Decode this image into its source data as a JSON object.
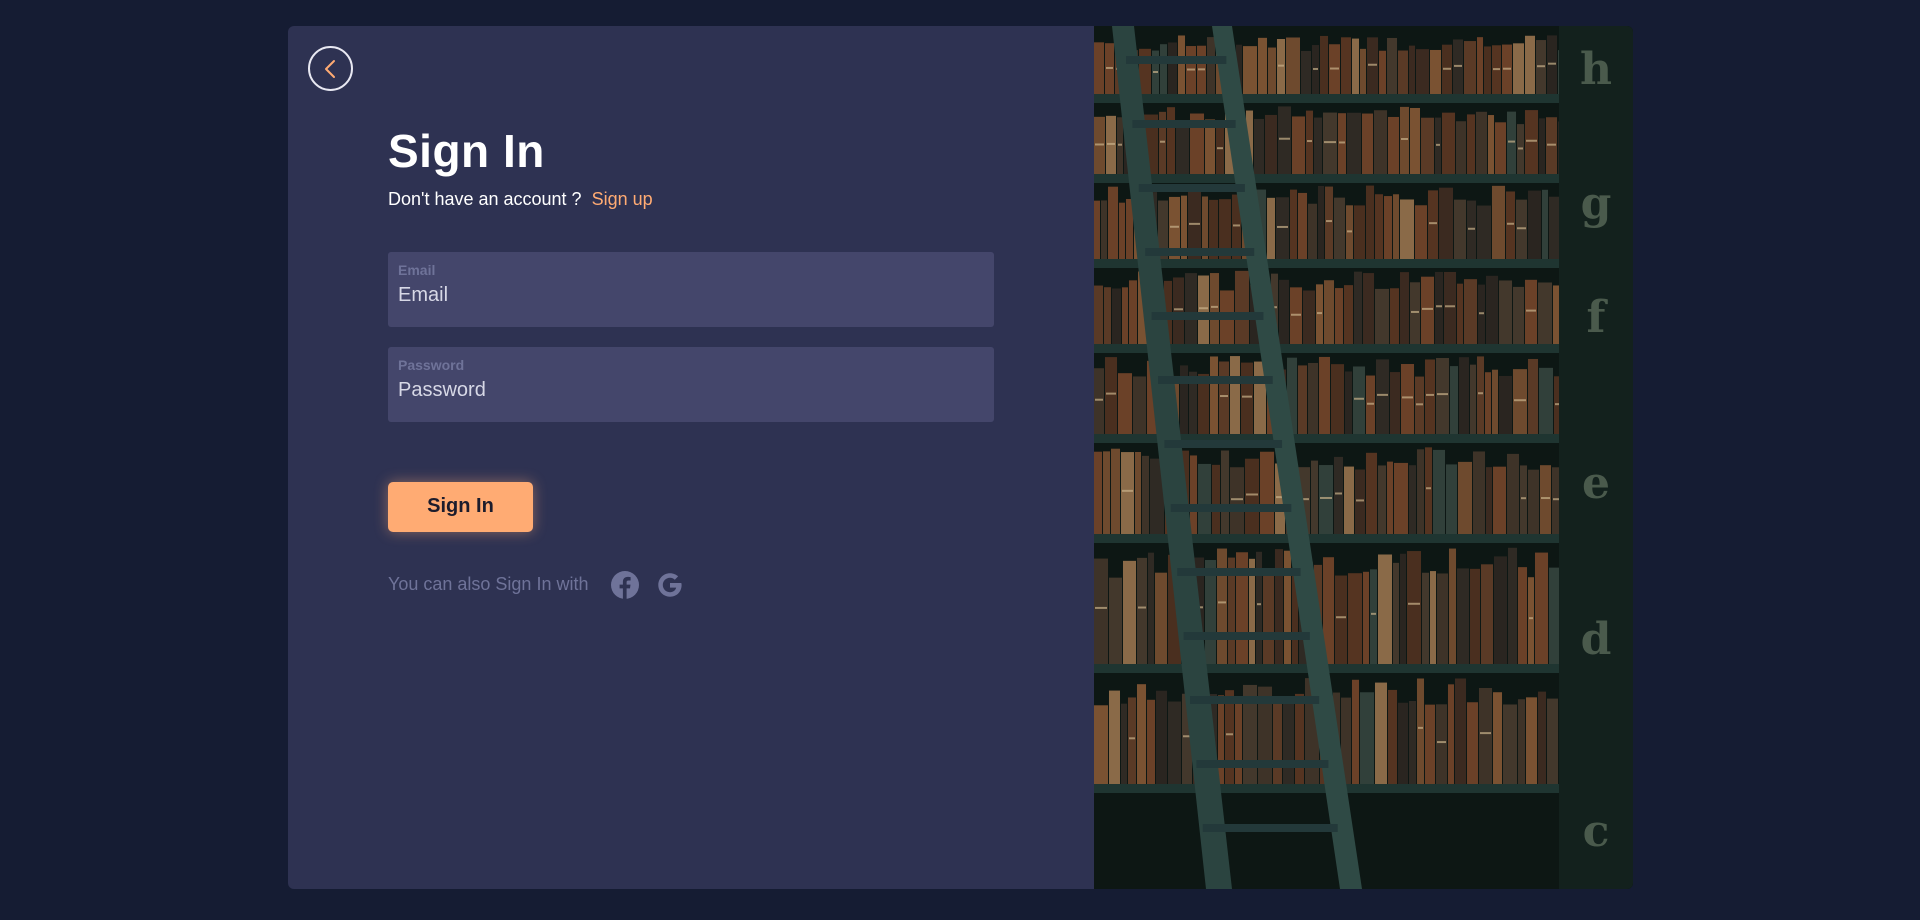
{
  "colors": {
    "background": "#151c33",
    "panel": "#2e3252",
    "field": "#44466b",
    "accent": "#ffab73",
    "muted": "#6f7399",
    "text": "#ffffff"
  },
  "header": {
    "back_icon": "chevron-left-icon",
    "title": "Sign In",
    "prompt": "Don't have an account ?",
    "signup_link": "Sign up"
  },
  "form": {
    "email": {
      "label": "Email",
      "placeholder": "Email",
      "value": ""
    },
    "password": {
      "label": "Password",
      "placeholder": "Password",
      "value": ""
    },
    "submit_label": "Sign In"
  },
  "social": {
    "text": "You can also Sign In with",
    "icons": [
      "facebook-icon",
      "google-icon"
    ]
  },
  "hero": {
    "image": "library-bookshelf-with-ladder",
    "shelf_letters": [
      "h",
      "g",
      "f",
      "e",
      "d",
      "c"
    ]
  }
}
